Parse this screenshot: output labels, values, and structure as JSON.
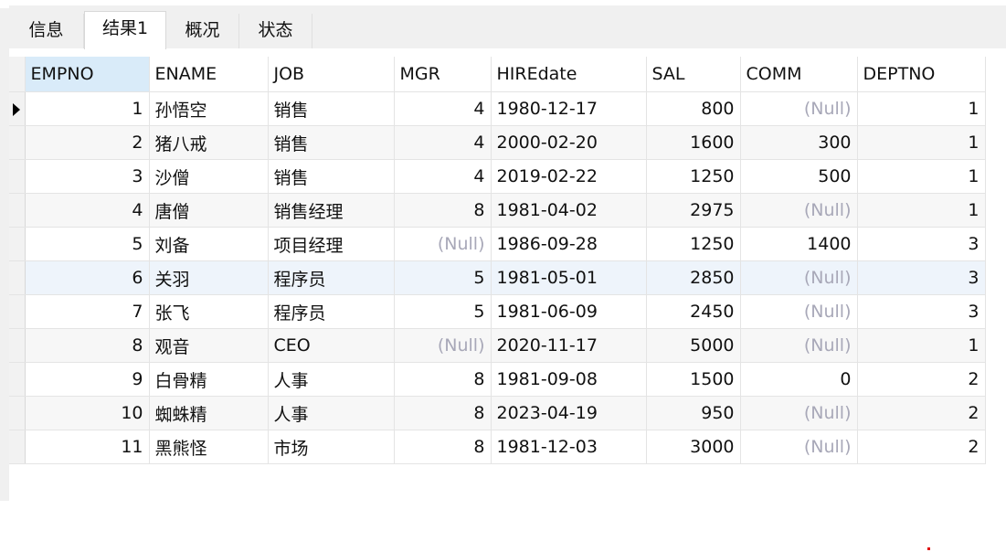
{
  "tabs": [
    {
      "label": "信息",
      "active": false
    },
    {
      "label": "结果1",
      "active": true
    },
    {
      "label": "概况",
      "active": false
    },
    {
      "label": "状态",
      "active": false
    }
  ],
  "table": {
    "columns": [
      "EMPNO",
      "ENAME",
      "JOB",
      "MGR",
      "HIREdate",
      "SAL",
      "COMM",
      "DEPTNO"
    ],
    "sorted_column": "EMPNO",
    "current_row": 0,
    "null_text": "(Null)",
    "rows": [
      [
        "1",
        "孙悟空",
        "销售",
        "4",
        "1980-12-17",
        "800",
        null,
        "1"
      ],
      [
        "2",
        "猪八戒",
        "销售",
        "4",
        "2000-02-20",
        "1600",
        "300",
        "1"
      ],
      [
        "3",
        "沙僧",
        "销售",
        "4",
        "2019-02-22",
        "1250",
        "500",
        "1"
      ],
      [
        "4",
        "唐僧",
        "销售经理",
        "8",
        "1981-04-02",
        "2975",
        null,
        "1"
      ],
      [
        "5",
        "刘备",
        "项目经理",
        null,
        "1986-09-28",
        "1250",
        "1400",
        "3"
      ],
      [
        "6",
        "关羽",
        "程序员",
        "5",
        "1981-05-01",
        "2850",
        null,
        "3"
      ],
      [
        "7",
        "张飞",
        "程序员",
        "5",
        "1981-06-09",
        "2450",
        null,
        "3"
      ],
      [
        "8",
        "观音",
        "CEO",
        null,
        "2020-11-17",
        "5000",
        null,
        "1"
      ],
      [
        "9",
        "白骨精",
        "人事",
        "8",
        "1981-09-08",
        "1500",
        "0",
        "2"
      ],
      [
        "10",
        "蜘蛛精",
        "人事",
        "8",
        "2023-04-19",
        "950",
        null,
        "2"
      ],
      [
        "11",
        "黑熊怪",
        "市场",
        "8",
        "1981-12-03",
        "3000",
        null,
        "2"
      ]
    ]
  },
  "colors": {
    "sorted_header": "#d9ebf9",
    "null_text": "#a8a8b8",
    "row_highlight": "#eef4fb",
    "tab_bar": "#f0f0f0"
  }
}
